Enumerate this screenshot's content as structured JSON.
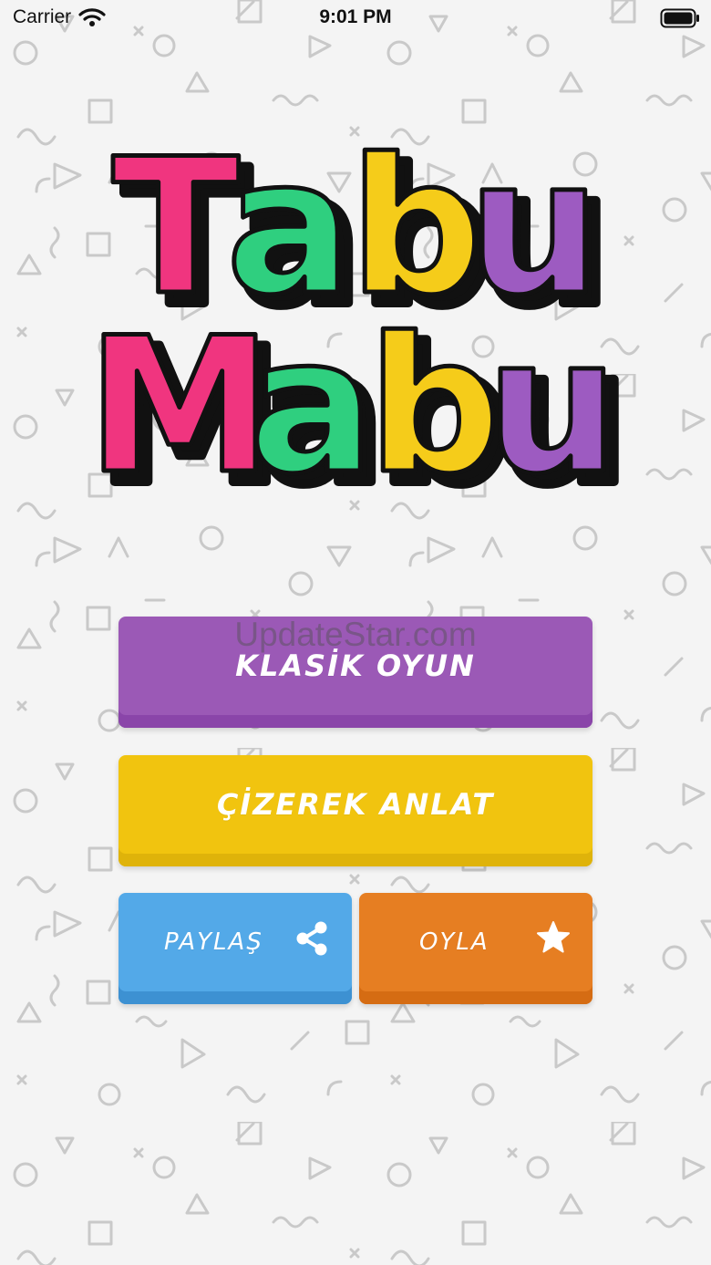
{
  "status_bar": {
    "carrier": "Carrier",
    "time": "9:01 PM"
  },
  "logo": {
    "line1": [
      "T",
      "a",
      "b",
      "u"
    ],
    "line2": [
      "M",
      "a",
      "b",
      "u"
    ],
    "colors": [
      "#f0357f",
      "#2fcf7f",
      "#f5cc1a",
      "#9d5bc1"
    ]
  },
  "watermark": "UpdateStar.com",
  "buttons": {
    "classic_label": "KLASİK OYUN",
    "draw_label": "ÇİZEREK ANLAT",
    "share_label": "PAYLAŞ",
    "rate_label": "OYLA"
  },
  "colors": {
    "classic": "#9b59b6",
    "draw": "#f1c40f",
    "share": "#53a9e8",
    "rate": "#e67e22",
    "background": "#f4f4f4"
  },
  "icons": {
    "wifi": "wifi-icon",
    "battery": "battery-icon",
    "share": "share-icon",
    "rate": "star-icon"
  }
}
